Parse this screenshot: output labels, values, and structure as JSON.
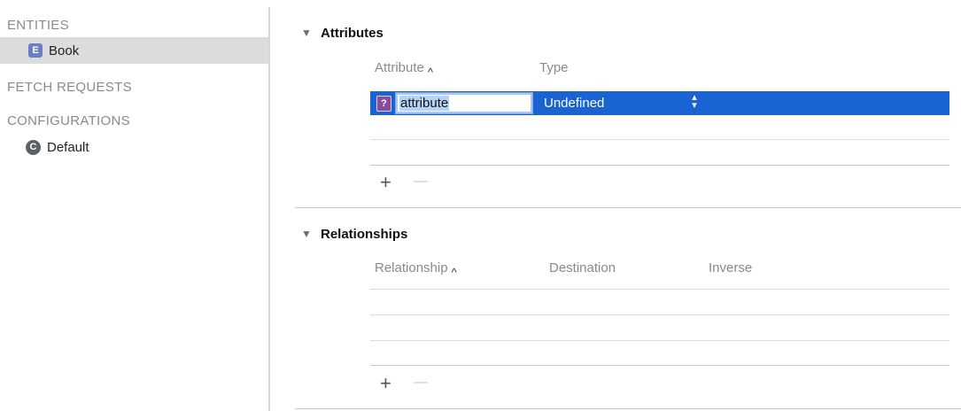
{
  "sidebar": {
    "sections": {
      "entities": "ENTITIES",
      "fetch_requests": "FETCH REQUESTS",
      "configurations": "CONFIGURATIONS"
    },
    "entity": {
      "badge": "E",
      "label": "Book",
      "selected": true
    },
    "configuration": {
      "badge": "C",
      "label": "Default"
    }
  },
  "attributes": {
    "title": "Attributes",
    "columns": {
      "attribute": "Attribute",
      "type": "Type"
    },
    "row": {
      "badge": "?",
      "name": "attribute",
      "type": "Undefined",
      "stepper": "⌃⌄"
    },
    "add_label": "+",
    "remove_label": "—"
  },
  "relationships": {
    "title": "Relationships",
    "columns": {
      "relationship": "Relationship",
      "destination": "Destination",
      "inverse": "Inverse"
    },
    "add_label": "+",
    "remove_label": "—"
  },
  "icons": {
    "disclosure": "▼",
    "sort_caret": "^"
  },
  "colors": {
    "selection": "#1a63d3",
    "entity_badge": "#6d7dc4",
    "config_badge": "#5b6167",
    "unknown_badge": "#8a4b9d"
  }
}
